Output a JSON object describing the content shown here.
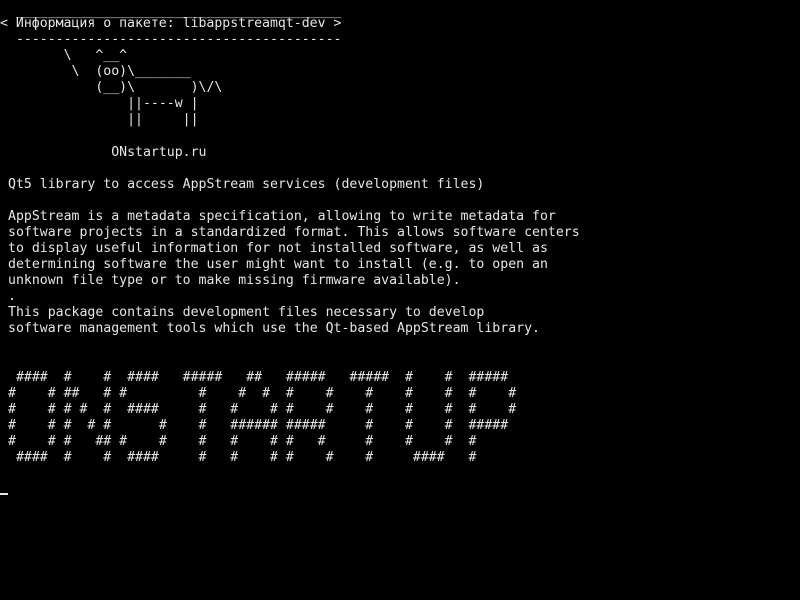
{
  "terminal": {
    "background": "#000000",
    "foreground": "#e6e6e6",
    "cowsay": {
      "bubble_top": " _________________________________________",
      "bubble_text": "< Информация о пакете: libappstreamqt-dev >",
      "bubble_bottom": " -----------------------------------------",
      "cow_1": "       \\   ^__^",
      "cow_2": "        \\  (oo)\\_______",
      "cow_3": "           (__)\\       )\\/\\",
      "cow_4": "               ||----w |",
      "cow_5": "               ||     ||",
      "site": "             ONstartup.ru"
    },
    "description": {
      "summary": "Qt5 library to access AppStream services (development files)",
      "para1_line1": "AppStream is a metadata specification, allowing to write metadata for",
      "para1_line2": "software projects in a standardized format. This allows software centers",
      "para1_line3": "to display useful information for not installed software, as well as",
      "para1_line4": "determining software the user might want to install (e.g. to open an",
      "para1_line5": "unknown file type or to make missing firmware available).",
      "separator": ".",
      "para2_line1": "This package contains development files necessary to develop",
      "para2_line2": "software management tools which use the Qt-based AppStream library."
    },
    "banner": {
      "row1": " ####  #    #  ####   #####   ##   #####   #####  #    #  #####",
      "row2": "#    # ##   # #         #    #  #  #    #    #    #    #  #    #",
      "row3": "#    # # #  #  ####     #   #    # #    #    #    #    #  #    #",
      "row4": "#    # #  # #      #    #   ###### #####     #    #    #  #####",
      "row5": "#    # #   ## #    #    #   #    # #   #     #    #    #  #",
      "row6": " ####  #    #  ####     #   #    # #    #    #     ####   #"
    }
  }
}
